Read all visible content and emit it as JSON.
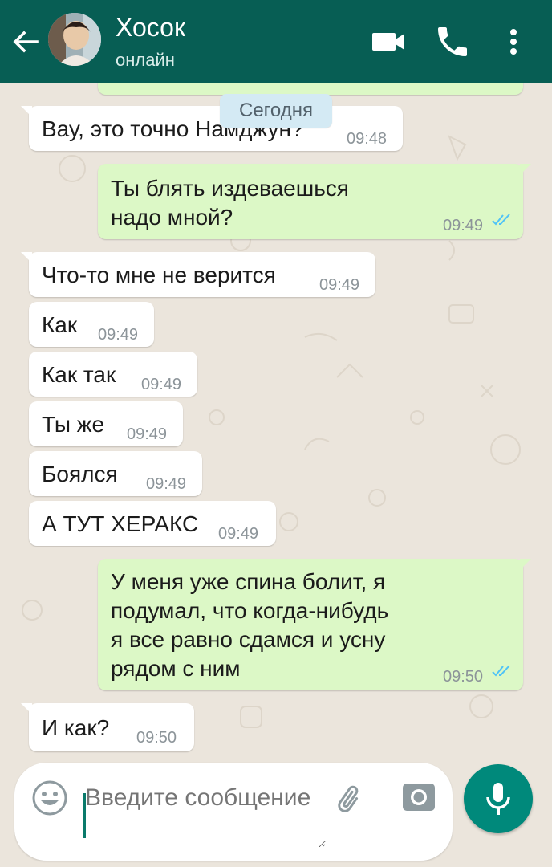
{
  "header": {
    "back_icon": "arrow-left-icon",
    "contact_name": "Хосок",
    "status": "онлайн",
    "video_icon": "video-camera-icon",
    "call_icon": "phone-icon",
    "menu_icon": "more-vertical-icon",
    "color": "#075e54"
  },
  "date_chip": "Сегодня",
  "messages": [
    {
      "dir": "in",
      "text": "Вау, это точно Намджун?",
      "time": "09:48"
    },
    {
      "dir": "out",
      "lines": [
        "Ты блять издеваешься",
        "надо мной?"
      ],
      "time": "09:49",
      "status": "read"
    },
    {
      "dir": "in",
      "text": "Что-то мне не верится",
      "time": "09:49"
    },
    {
      "dir": "in",
      "text": "Как",
      "time": "09:49"
    },
    {
      "dir": "in",
      "text": "Как так",
      "time": "09:49"
    },
    {
      "dir": "in",
      "text": "Ты же",
      "time": "09:49"
    },
    {
      "dir": "in",
      "text": "Боялся",
      "time": "09:49"
    },
    {
      "dir": "in",
      "text": "А ТУТ ХЕРАКС",
      "time": "09:49"
    },
    {
      "dir": "out",
      "lines": [
        "У меня уже спина болит, я",
        "подумал, что когда-нибудь",
        "я все равно сдамся и усну",
        "рядом с ним"
      ],
      "time": "09:50",
      "status": "read"
    },
    {
      "dir": "in",
      "text": "И как?",
      "time": "09:50"
    }
  ],
  "composer": {
    "placeholder": "Введите сообщение",
    "emoji_icon": "emoji-icon",
    "attach_icon": "paperclip-icon",
    "camera_icon": "camera-icon",
    "mic_icon": "microphone-icon",
    "accent": "#00897b"
  },
  "colors": {
    "incoming_bubble": "#ffffff",
    "outgoing_bubble": "#dcf8c6",
    "read_ticks": "#4fc3f7"
  }
}
